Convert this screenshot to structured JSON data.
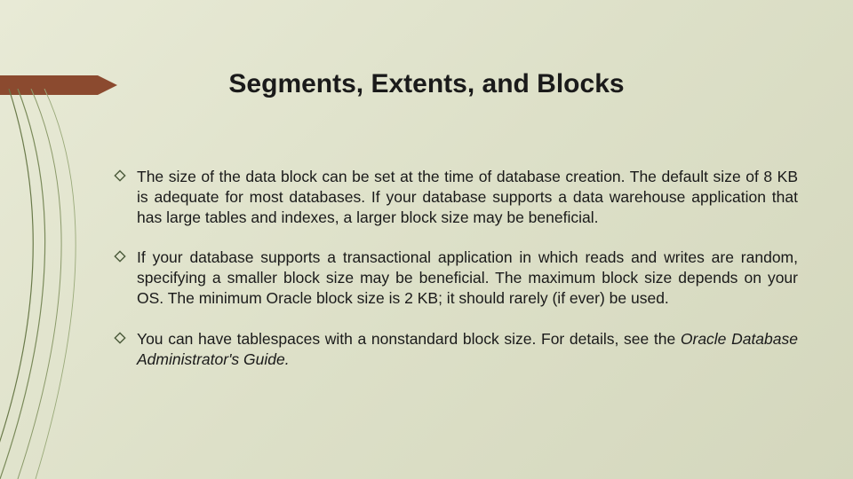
{
  "title": "Segments, Extents, and Blocks",
  "bullets": [
    {
      "text": "The size of the data block can be set at the time of database creation. The default size of 8 KB is adequate for most databases. If your database supports a data warehouse application that has large tables and indexes, a larger block size may be beneficial."
    },
    {
      "text": "If your database supports a transactional application in which reads and writes are random, specifying a smaller block size may be beneficial. The maximum block size depends on your OS. The minimum Oracle block size is 2 KB; it should rarely (if ever) be used."
    },
    {
      "text_pre": "You can have tablespaces with a nonstandard block size. For details, see the ",
      "text_em": "Oracle Database Administrator's Guide.",
      "text_post": ""
    }
  ]
}
